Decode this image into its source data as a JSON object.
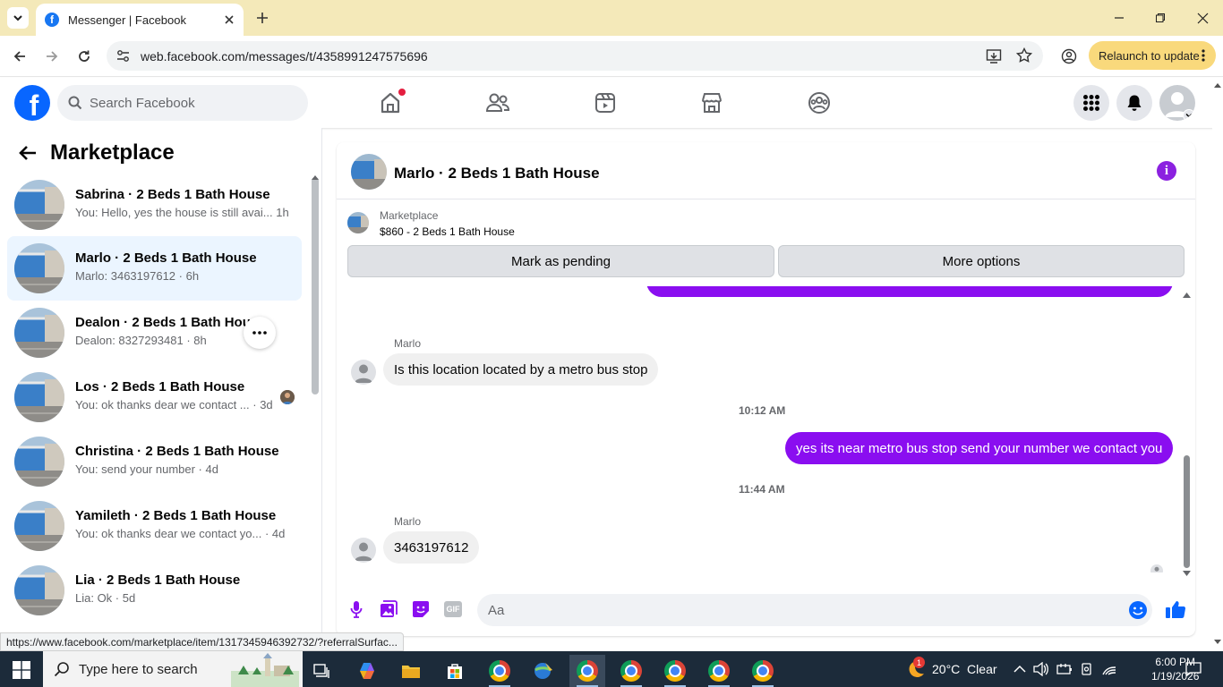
{
  "browser": {
    "tab_title": "Messenger | Facebook",
    "url": "web.facebook.com/messages/t/4358991247575696",
    "relaunch_label": "Relaunch to update",
    "status_url": "https://www.facebook.com/marketplace/item/1317345946392732/?referralSurfac..."
  },
  "fb_header": {
    "logo_letter": "f",
    "search_placeholder": "Search Facebook"
  },
  "sidebar": {
    "title": "Marketplace",
    "conversations": [
      {
        "name": "Sabrina · 2 Beds 1 Bath House",
        "preview": "You: Hello, yes the house is still avai... 1h",
        "selected": false
      },
      {
        "name": "Marlo · 2 Beds 1 Bath House",
        "preview": "Marlo: 3463197612 · 6h",
        "selected": true
      },
      {
        "name": "Dealon · 2 Beds 1 Bath House",
        "preview": "Dealon: 8327293481 · 8h",
        "selected": false
      },
      {
        "name": "Los · 2 Beds 1 Bath House",
        "preview": "You: ok thanks dear we contact ... · 3d",
        "selected": false
      },
      {
        "name": "Christina · 2 Beds 1 Bath House",
        "preview": "You: send your number · 4d",
        "selected": false
      },
      {
        "name": "Yamileth · 2 Beds 1 Bath House",
        "preview": "You: ok thanks dear we contact yo... · 4d",
        "selected": false
      },
      {
        "name": "Lia · 2 Beds 1 Bath House",
        "preview": "Lia: Ok · 5d",
        "selected": false
      }
    ]
  },
  "chat": {
    "title": "Marlo · 2 Beds 1 Bath House",
    "listing_label": "Marketplace",
    "listing_price": "$860 - 2 Beds 1 Bath House",
    "mark_pending_label": "Mark as pending",
    "more_options_label": "More options",
    "messages": {
      "sender1": "Marlo",
      "msg1": "Is this location located by a metro bus stop",
      "time1": "10:12 AM",
      "msg2": "yes its near metro bus stop send your number we contact you",
      "time2": "11:44 AM",
      "sender2": "Marlo",
      "msg3": "3463197612"
    },
    "compose_placeholder": "Aa",
    "gif_label": "GIF"
  },
  "taskbar": {
    "search_placeholder": "Type here to search",
    "weather": "20°C  Clear",
    "weather_badge": "1",
    "time": "6:00 PM",
    "date": "1/19/2026"
  },
  "colors": {
    "accent_purple": "#8a0ef0",
    "fb_blue": "#0866ff",
    "selected_row": "#ebf5ff",
    "relaunch_bg": "#f9d97c"
  }
}
